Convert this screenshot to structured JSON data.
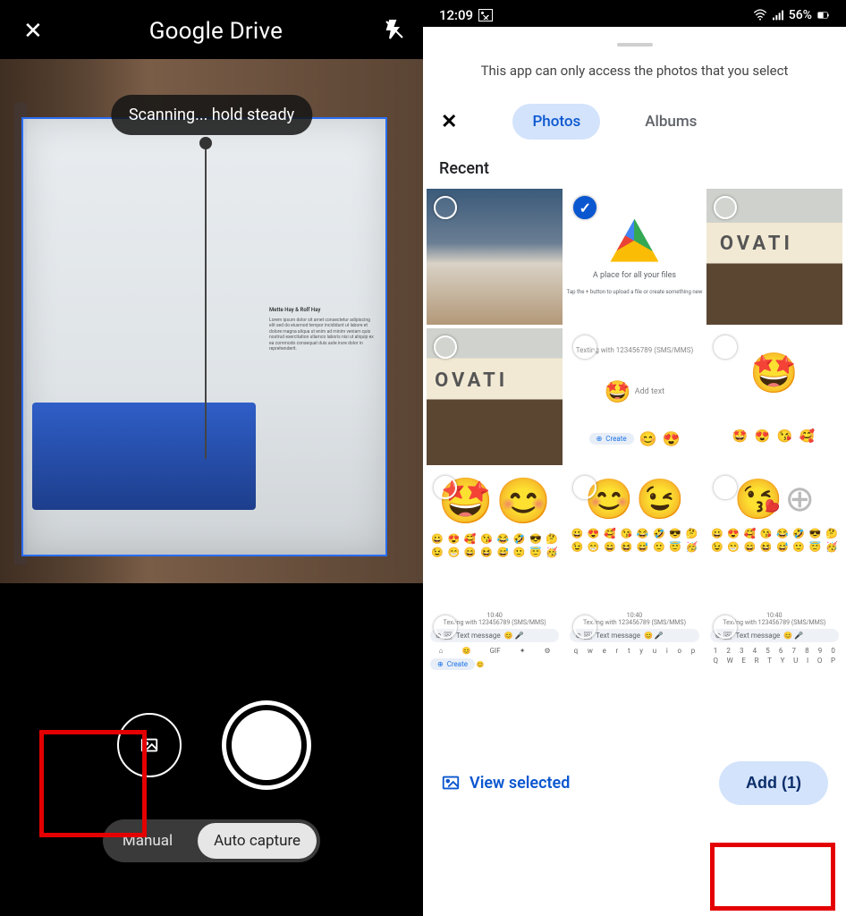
{
  "left": {
    "title": "Google Drive",
    "scanning_msg": "Scanning... hold steady",
    "modes": {
      "manual": "Manual",
      "auto": "Auto capture"
    }
  },
  "right": {
    "status": {
      "time": "12:09",
      "battery": "56%"
    },
    "access_msg": "This app can only access the photos that you select",
    "tabs": {
      "photos": "Photos",
      "albums": "Albums"
    },
    "section": "Recent",
    "thumb2": {
      "caption1": "A place for all your files",
      "caption2": "Tap the + button to upload a file or create something new"
    },
    "thumb3": {
      "text": "OVATI"
    },
    "thumb4": {
      "text": "OVATI"
    },
    "thumb5": {
      "add_text": "Add text",
      "create": "Create"
    },
    "thumb10": {
      "time": "10:40",
      "head": "Texting with 123456789 (SMS/MMS)",
      "msg": "Text message",
      "create": "Create"
    },
    "thumb11": {
      "time": "10:40",
      "head": "Texting with 123456789 (SMS/MMS)",
      "msg": "Text message"
    },
    "thumb12": {
      "time": "10:40",
      "head": "Texting with 123456789 (SMS/MMS)",
      "msg": "Text message"
    },
    "view_selected": "View selected",
    "add_btn": "Add (1)"
  }
}
